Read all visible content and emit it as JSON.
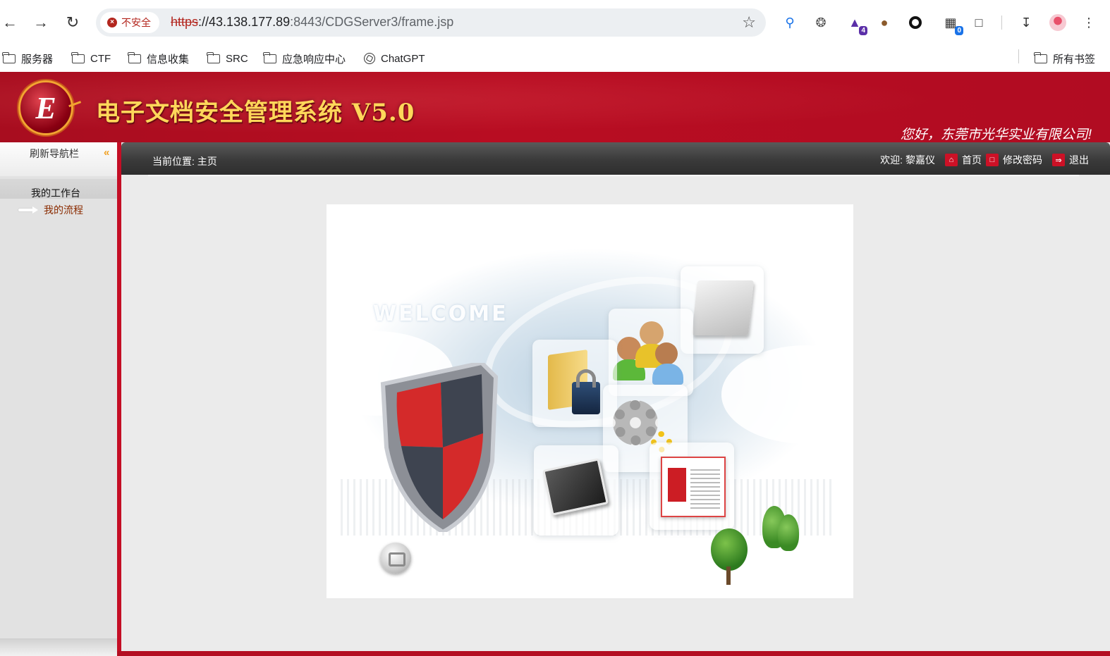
{
  "browser": {
    "security_label": "不安全",
    "url_scheme": "https",
    "url_host": "://43.138.177.89",
    "url_port_path": ":8443/CDGServer3/frame.jsp",
    "extension_badges": {
      "ext4": "4",
      "ext6": "0"
    }
  },
  "bookmarks": {
    "items": [
      {
        "label": "服务器"
      },
      {
        "label": "CTF"
      },
      {
        "label": "信息收集"
      },
      {
        "label": "SRC"
      },
      {
        "label": "应急响应中心"
      },
      {
        "label": "ChatGPT"
      }
    ],
    "all_bookmarks": "所有书签"
  },
  "header": {
    "logo_letter": "E",
    "title": "电子文档安全管理系统 V5.0",
    "greeting": "您好，东莞市光华实业有限公司!"
  },
  "sidebar": {
    "refresh": "刷新导航栏",
    "section": "我的工作台",
    "items": [
      {
        "label": "我的流程"
      }
    ]
  },
  "topbar": {
    "location_label": "当前位置:",
    "location_value": "主页",
    "welcome_label": "欢迎:",
    "user_name": "黎嘉仪",
    "home": "首页",
    "change_password": "修改密码",
    "logout": "退出"
  },
  "welcome": {
    "word": "WELCOME"
  },
  "colors": {
    "brand_red": "#b80d22",
    "title_gold": "#ffd75a",
    "topbar_dark": "#3a3a3a"
  }
}
